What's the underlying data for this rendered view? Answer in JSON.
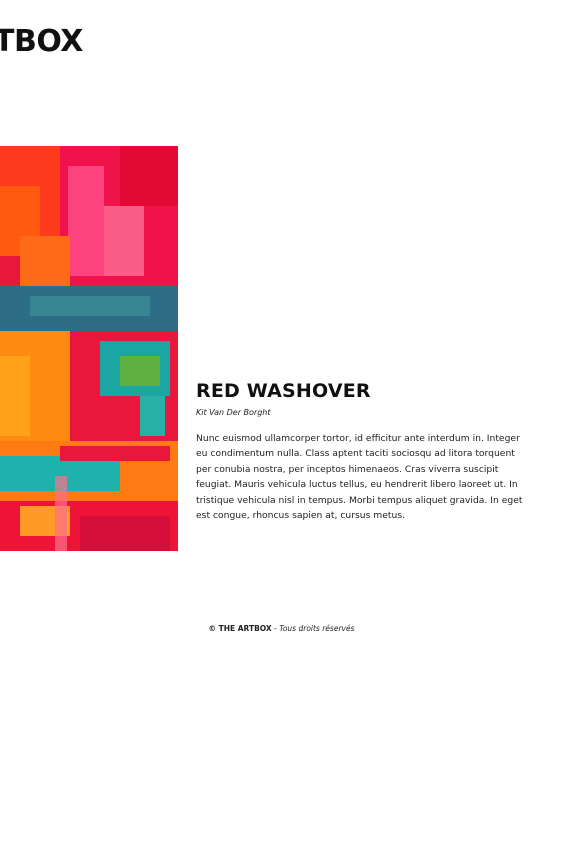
{
  "header": {
    "logo_text": "TBOX"
  },
  "artwork": {
    "title": "RED WASHOVER",
    "artist": "Kit Van Der Borght",
    "description": "Nunc euismod ullamcorper tortor, id efficitur ante interdum in. Integer eu condimentum nulla. Class aptent taciti sociosqu ad litora torquent per conubia nostra, per inceptos himenaeos. Cras viverra suscipit feugiat. Mauris vehicula luctus tellus, eu hendrerit libero laoreet ut. In tristique vehicula nisl in tempus. Morbi tempus aliquet gravida. In eget est congue, rhoncus sapien at, cursus metus."
  },
  "footer": {
    "copyright": "© THE ARTBOX",
    "separator": " - ",
    "rights": "Tous droits réservés"
  },
  "colors": {
    "background": "#ffffff",
    "text": "#111111",
    "painting_red": "#e8173b",
    "painting_orange": "#ff7a12",
    "painting_teal": "#15a9a6"
  }
}
